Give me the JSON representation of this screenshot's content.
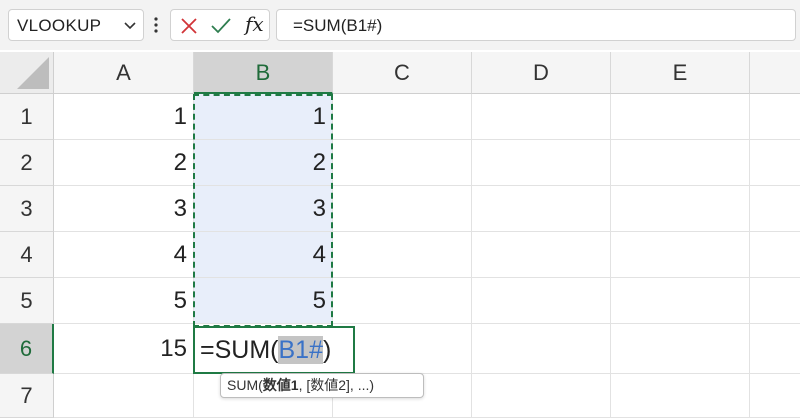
{
  "formula_bar": {
    "name_box": "VLOOKUP",
    "fx_label": "fx",
    "formula": "=SUM(B1#)"
  },
  "columns": [
    "A",
    "B",
    "C",
    "D",
    "E"
  ],
  "rows": [
    "1",
    "2",
    "3",
    "4",
    "5",
    "6",
    "7"
  ],
  "cells": {
    "A": [
      "1",
      "2",
      "3",
      "4",
      "5",
      "15",
      ""
    ],
    "B": [
      "1",
      "2",
      "3",
      "4",
      "5",
      "",
      ""
    ]
  },
  "active_cell": {
    "prefix": "=SUM(",
    "reference": "B1#",
    "suffix": ")"
  },
  "tooltip": {
    "func": "SUM(",
    "arg1": "数値1",
    "rest": ", [数値2], ...)"
  },
  "colors": {
    "accent_green": "#1f7a44",
    "range_fill": "#e8eefa",
    "reference_blue": "#3a72c7"
  }
}
